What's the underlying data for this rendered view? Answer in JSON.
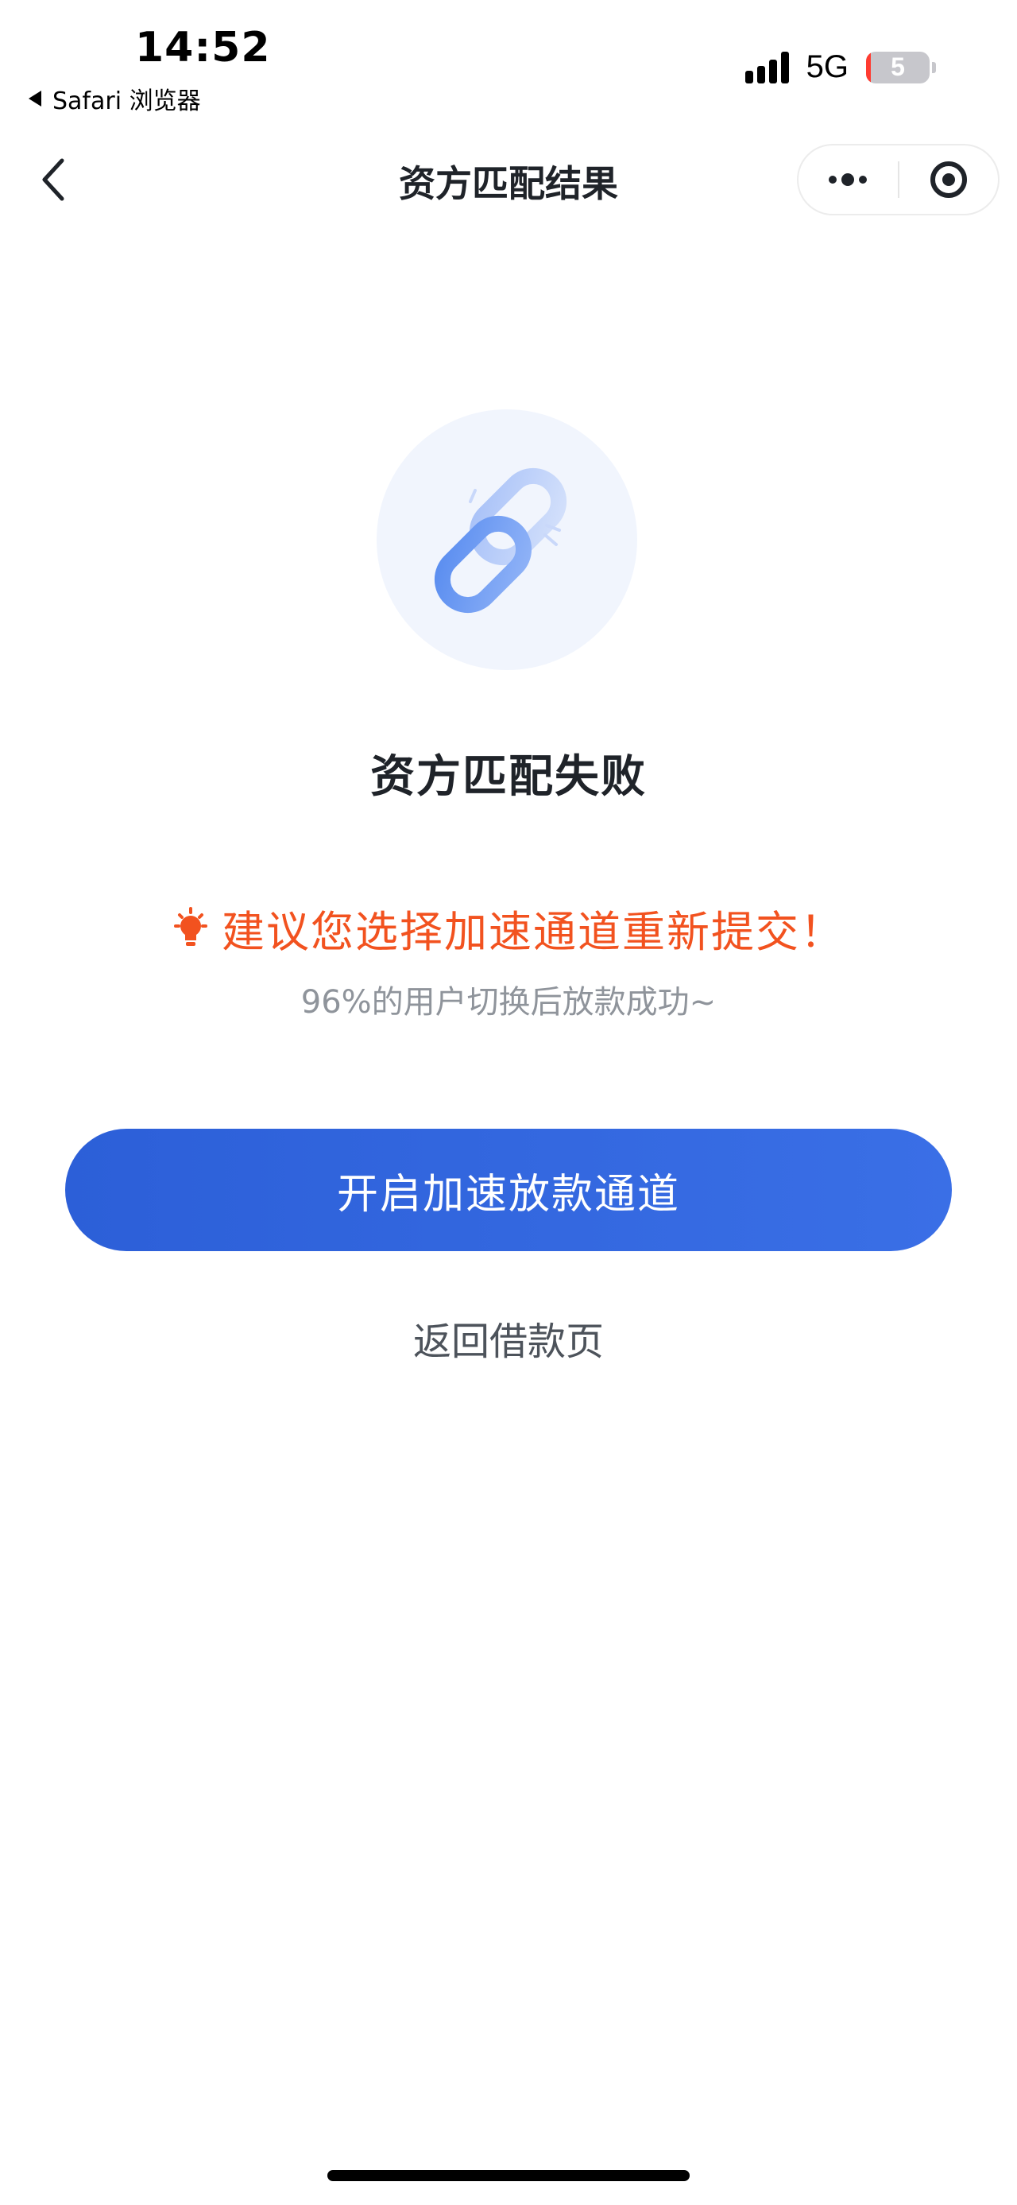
{
  "status_bar": {
    "time": "14:52",
    "back_app": "Safari 浏览器",
    "network": "5G",
    "battery": "5",
    "battery_fraction": 0.05
  },
  "nav": {
    "title": "资方匹配结果"
  },
  "result": {
    "title": "资方匹配失败",
    "suggestion": "建议您选择加速通道重新提交！",
    "note": "96%的用户切换后放款成功~"
  },
  "actions": {
    "primary": "开启加速放款通道",
    "secondary": "返回借款页"
  },
  "colors": {
    "accent": "#2c5fd8",
    "warning": "#f2521f",
    "text_primary": "#1f2329",
    "text_secondary": "#8f949b"
  },
  "icons": {
    "back": "chevron-left-icon",
    "more": "more-dots-icon",
    "close": "target-circle-icon",
    "illustration": "broken-chain-icon",
    "tip": "lightbulb-icon"
  }
}
